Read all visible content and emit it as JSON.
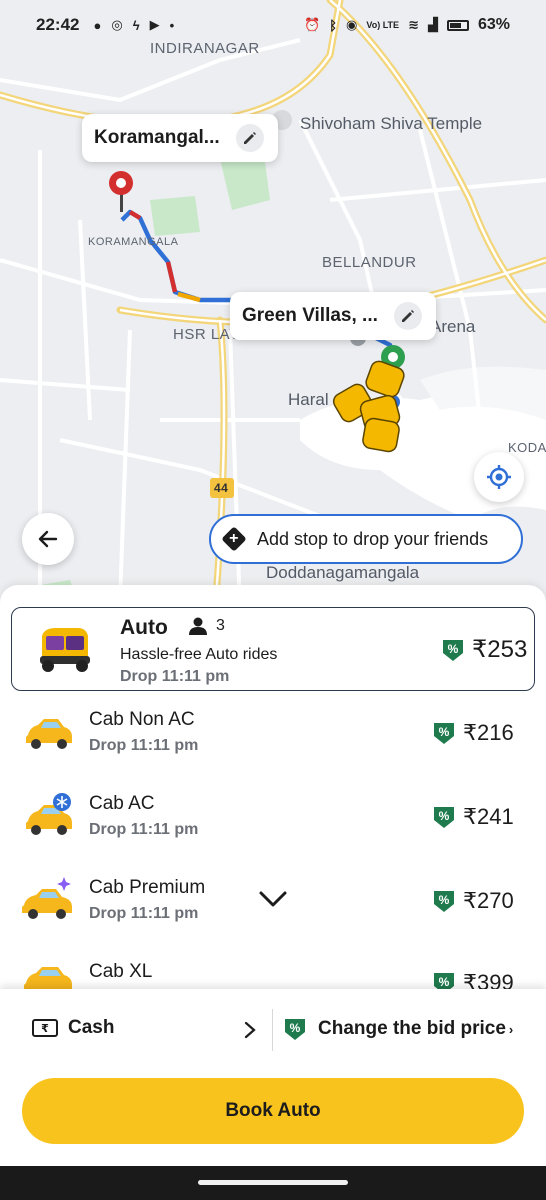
{
  "status_bar": {
    "time": "22:42",
    "battery_percent": "63%",
    "left_icons": [
      "chat-icon",
      "instagram-icon",
      "bolt-icon",
      "youtube-icon",
      "dot-icon"
    ],
    "right_icons": [
      "alarm-icon",
      "bluetooth-icon",
      "location-icon",
      "volte-icon",
      "wifi-icon",
      "signal-icon",
      "battery-icon"
    ],
    "volte_label": "Vo) LTE"
  },
  "map": {
    "labels": {
      "indiranagar": "INDIRANAGAR",
      "koramangala": "KORAMANGALA",
      "bellandur": "BELLANDUR",
      "hsr": "HSR LAYOUT",
      "haral": "Haral",
      "arena": "Arena",
      "kodat": "KODAT",
      "doddanagamangala": "Doddanagamangala",
      "shivoham": "Shivoham Shiva Temple",
      "highway": "44"
    },
    "pickup_label": "Koramangal...",
    "drop_label": "Green Villas, ...",
    "add_stop_label": "Add stop to drop your friends",
    "colors": {
      "route": "#3b82f6",
      "pickup_pin": "#d32f2f",
      "drop_pin": "#2e9e4f",
      "autos": "#f5b800"
    }
  },
  "rides": [
    {
      "name": "Auto",
      "seats": "3",
      "tagline": "Hassle-free Auto rides",
      "drop": "Drop 11:11 pm",
      "price": "₹253",
      "selected": true,
      "icon": "auto-rickshaw-icon"
    },
    {
      "name": "Cab Non AC",
      "drop": "Drop 11:11 pm",
      "price": "₹216",
      "icon": "cab-icon"
    },
    {
      "name": "Cab AC",
      "drop": "Drop 11:11 pm",
      "price": "₹241",
      "icon": "cab-ac-icon"
    },
    {
      "name": "Cab Premium",
      "drop": "Drop 11:11 pm",
      "price": "₹270",
      "icon": "cab-premium-icon"
    },
    {
      "name": "Cab XL",
      "price": "₹399",
      "icon": "cab-xl-icon"
    }
  ],
  "discount_badge": "%",
  "payment": {
    "method": "Cash",
    "cash_symbol": "₹",
    "bid_label": "Change the bid price"
  },
  "book_button": "Book Auto",
  "colors": {
    "accent": "#f9c31d",
    "discount_badge": "#1f7a4d",
    "selected_border": "#2e3a4d"
  }
}
